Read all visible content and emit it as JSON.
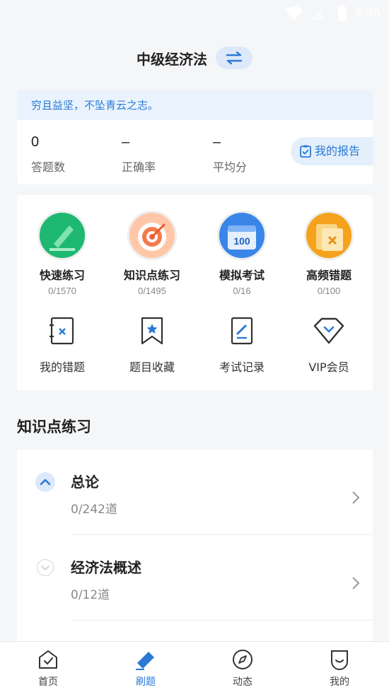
{
  "status": {
    "time": "4:45"
  },
  "header": {
    "title": "中级经济法"
  },
  "stats": {
    "motto": "穷且益坚，不坠青云之志。",
    "items": [
      {
        "value": "0",
        "label": "答题数"
      },
      {
        "value": "–",
        "label": "正确率"
      },
      {
        "value": "–",
        "label": "平均分"
      }
    ],
    "report_label": "我的报告"
  },
  "practice": [
    {
      "name": "快速练习",
      "count": "0/1570"
    },
    {
      "name": "知识点练习",
      "count": "0/1495"
    },
    {
      "name": "模拟考试",
      "count": "0/16",
      "badge": "100"
    },
    {
      "name": "高频错题",
      "count": "0/100"
    }
  ],
  "tools": [
    {
      "name": "我的错题"
    },
    {
      "name": "题目收藏"
    },
    {
      "name": "考试记录"
    },
    {
      "name": "VIP会员"
    }
  ],
  "section_title": "知识点练习",
  "chapters": [
    {
      "name": "总论",
      "progress": "0/242道",
      "expanded": true
    },
    {
      "name": "经济法概述",
      "progress": "0/12道",
      "expanded": false
    }
  ],
  "tabs": [
    {
      "label": "首页"
    },
    {
      "label": "刷题"
    },
    {
      "label": "动态"
    },
    {
      "label": "我的"
    }
  ],
  "colors": {
    "accent": "#2a7ad5",
    "background": "#f5f6f8"
  }
}
